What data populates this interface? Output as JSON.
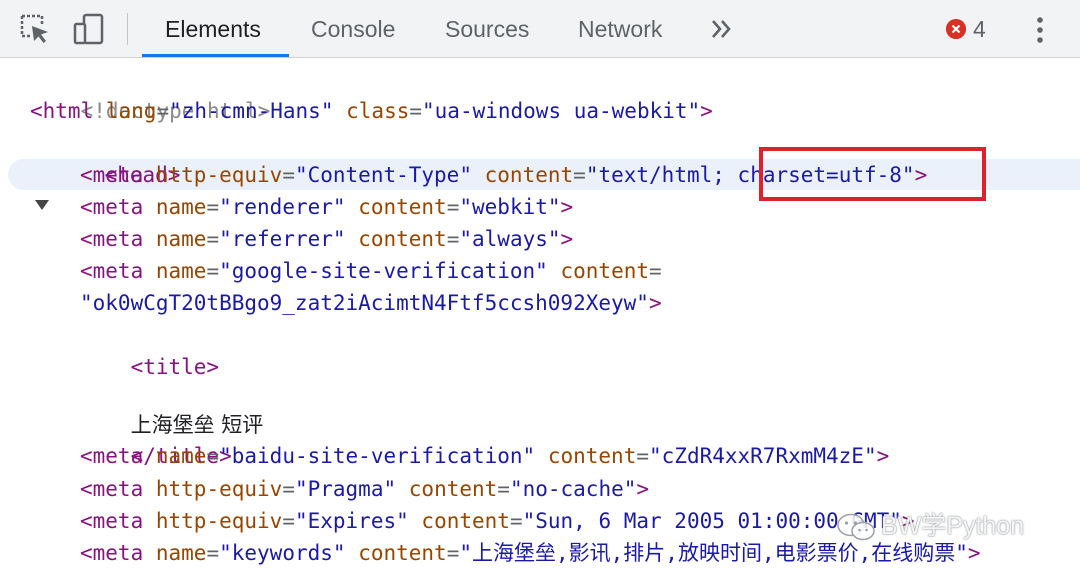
{
  "toolbar": {
    "inspect_icon": "inspect-element-icon",
    "device_icon": "device-toolbar-icon",
    "tabs": [
      {
        "label": "Elements",
        "active": true
      },
      {
        "label": "Console",
        "active": false
      },
      {
        "label": "Sources",
        "active": false
      },
      {
        "label": "Network",
        "active": false
      }
    ],
    "more_tabs_icon": "double-chevron-icon",
    "error_count": "4",
    "menu_icon": "kebab-menu-icon"
  },
  "colors": {
    "tag": "#881280",
    "attr": "#994500",
    "value": "#1a1aa6",
    "selection": "#eaf1fb",
    "accent": "#1a73e8",
    "error": "#d93025",
    "annotation_box": "#e0212d"
  },
  "dom": {
    "doctype": "<!doctype html>",
    "html_open": {
      "tag_open": "<html",
      "attr1": "lang",
      "val1": "\"zh-cmn-Hans\"",
      "attr2": "class",
      "val2": "\"ua-windows ua-webkit\"",
      "close": ">"
    },
    "head_open": "<head>",
    "meta_content_type": {
      "tag_open": "<meta",
      "attr1": "http-equiv",
      "val1": "\"Content-Type\"",
      "attr2": "content",
      "val2a": "\"text/html;",
      "val2b": "charset=utf-8\"",
      "close": ">"
    },
    "meta_renderer": {
      "tag_open": "<meta",
      "attr1": "name",
      "val1": "\"renderer\"",
      "attr2": "content",
      "val2": "\"webkit\"",
      "close": ">"
    },
    "meta_referrer": {
      "tag_open": "<meta",
      "attr1": "name",
      "val1": "\"referrer\"",
      "attr2": "content",
      "val2": "\"always\"",
      "close": ">"
    },
    "meta_google": {
      "tag_open": "<meta",
      "attr1": "name",
      "val1": "\"google-site-verification\"",
      "attr2": "content",
      "val2": "\"ok0wCgT20tBBgo9_zat2iAcimtN4Ftf5ccsh092Xeyw\"",
      "close": ">"
    },
    "title_open": "<title>",
    "title_text": "上海堡垒 短评",
    "title_close": "</title>",
    "meta_baidu": {
      "tag_open": "<meta",
      "attr1": "name",
      "val1": "\"baidu-site-verification\"",
      "attr2": "content",
      "val2": "\"cZdR4xxR7RxmM4zE\"",
      "close": ">"
    },
    "meta_pragma": {
      "tag_open": "<meta",
      "attr1": "http-equiv",
      "val1": "\"Pragma\"",
      "attr2": "content",
      "val2": "\"no-cache\"",
      "close": ">"
    },
    "meta_expires": {
      "tag_open": "<meta",
      "attr1": "http-equiv",
      "val1": "\"Expires\"",
      "attr2": "content",
      "val2": "\"Sun, 6 Mar 2005 01:00:00 GMT\"",
      "close": ">"
    },
    "meta_keywords": {
      "tag_open": "<meta",
      "attr1": "name",
      "val1": "\"keywords\"",
      "attr2": "content",
      "val2": "\"上海堡垒,影讯,排片,放映时间,电影票价,在线购票\"",
      "close": ">"
    }
  },
  "watermark": {
    "icon": "wechat-icon",
    "text": "BW学Python"
  }
}
